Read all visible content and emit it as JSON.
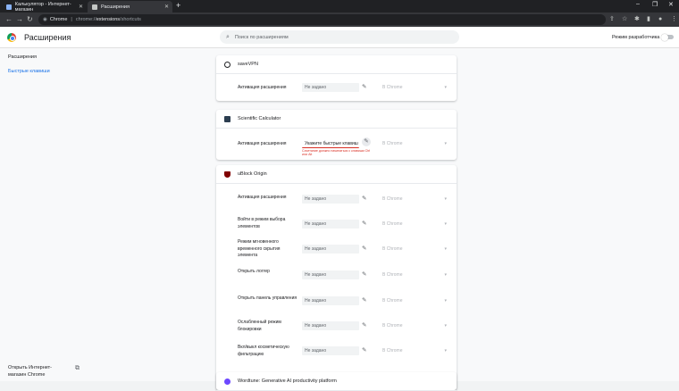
{
  "browser": {
    "tabs": [
      {
        "title": "Калькулятор - Интернет-магазин"
      },
      {
        "title": "Расширения"
      }
    ],
    "new_tab_icon": "+",
    "omnibox": {
      "site_label": "Chrome",
      "url_prefix": "chrome://",
      "url_host": "extensions",
      "url_path": "/shortcuts"
    },
    "window_controls": [
      "minimize-icon",
      "maximize-icon",
      "close-icon"
    ]
  },
  "header": {
    "title": "Расширения",
    "search_placeholder": "Поиск по расширениям",
    "dev_mode_label": "Режим разработчика",
    "dev_mode_on": false
  },
  "sidebar": {
    "items": [
      {
        "label": "Расширения"
      },
      {
        "label": "Быстрые клавиши"
      }
    ],
    "store_link": "Открыть Интернет-магазин Chrome"
  },
  "colors": {
    "accent": "#1a73e8",
    "error": "#d93025",
    "ublock": "#800000"
  },
  "extensions": [
    {
      "name": "saveVPN",
      "icon": "vpn-icon",
      "shortcuts": [
        {
          "label": "Активация расширения",
          "value": "Не задано",
          "scope": "В Chrome"
        }
      ]
    },
    {
      "name": "Scientific Calculator",
      "icon": "calculator-icon",
      "shortcuts": [
        {
          "label": "Активация расширения",
          "value": "Укажите быстрые клавиш",
          "scope": "В Chrome",
          "error": "Сочетание должно начинаться с клавиши Ctrl или Alt"
        }
      ]
    },
    {
      "name": "uBlock Origin",
      "icon": "shield-icon",
      "shortcuts": [
        {
          "label": "Активация расширения",
          "value": "Не задано",
          "scope": "В Chrome"
        },
        {
          "label": "Войти в режим выбора элементов",
          "value": "Не задано",
          "scope": "В Chrome"
        },
        {
          "label": "Режим мгновенного временного скрытия элемента",
          "value": "Не задано",
          "scope": "В Chrome"
        },
        {
          "label": "Открыть логгер",
          "value": "Не задано",
          "scope": "В Chrome"
        },
        {
          "label": "Открыть панель управления",
          "value": "Не задано",
          "scope": "В Chrome"
        },
        {
          "label": "Ослабленный режим блокировки",
          "value": "Не задано",
          "scope": "В Chrome"
        },
        {
          "label": "Вкл/выкл косметическую фильтрацию",
          "value": "Не задано",
          "scope": "В Chrome"
        }
      ]
    },
    {
      "name": "Wordtune: Generative AI productivity platform",
      "icon": "wordtune-icon"
    }
  ]
}
